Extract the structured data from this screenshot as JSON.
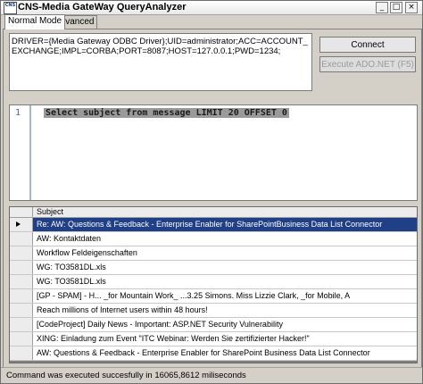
{
  "window": {
    "title": "CNS-Media GateWay QueryAnalyzer",
    "icon_text": "CNS",
    "controls": {
      "minimize": "_",
      "maximize": "□",
      "close": "×"
    }
  },
  "tabs": [
    {
      "label": "Normal Mode",
      "active": true
    },
    {
      "label": "Advanced",
      "active": false
    }
  ],
  "connection_string": "DRIVER={Media Gateway ODBC Driver};UID=administrator;ACC=ACCOUNT_EXCHANGE;IMPL=CORBA;PORT=8087;HOST=127.0.0.1;PWD=1234;",
  "buttons": {
    "connect": "Connect",
    "execute": "Execute ADO.NET (F5)"
  },
  "editor": {
    "line_number": "1",
    "query": "Select subject from message LIMIT 20 OFFSET 0"
  },
  "results": {
    "column": "Subject",
    "rows": [
      "Re: AW: Questions & Feedback - Enterprise Enabler for SharePointBusiness Data List Connector",
      "AW: Kontaktdaten",
      "Workflow Feldeigenschaften",
      "WG: TO3581DL.xls",
      "WG: TO3581DL.xls",
      "[GP - SPAM] - H... _for Mountain Work_ ...3.25 Simons. Miss Lizzie Clark, _for Mobile, A",
      "Reach millions of Internet users within 48 hours!",
      "[CodeProject] Daily News - Important: ASP.NET Security Vulnerability",
      "XING: Einladung zum Event \"ITC Webinar: Werden Sie zertifizierter Hacker!\"",
      "AW: Questions & Feedback - Enterprise Enabler for SharePoint Business Data List Connector"
    ]
  },
  "status": "Command was executed succesfully in 16065,8612 miliseconds",
  "colors": {
    "selection": "#1f3f86",
    "window_bg": "#d4d0c8"
  }
}
